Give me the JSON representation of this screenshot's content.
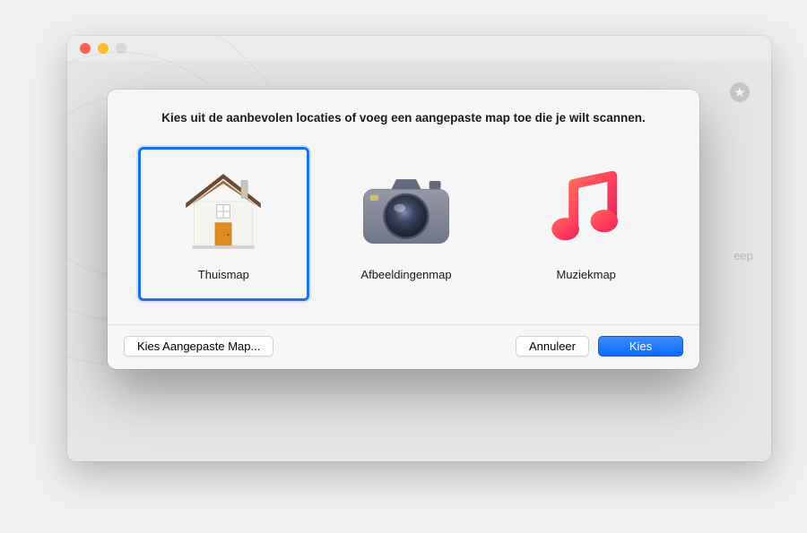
{
  "background": {
    "partial_text": "eep"
  },
  "modal": {
    "title": "Kies uit de aanbevolen locaties of voeg een aangepaste map toe die je wilt scannen.",
    "options": {
      "home": {
        "label": "Thuismap"
      },
      "pictures": {
        "label": "Afbeeldingenmap"
      },
      "music": {
        "label": "Muziekmap"
      }
    },
    "buttons": {
      "custom_folder": "Kies Aangepaste Map...",
      "cancel": "Annuleer",
      "choose": "Kies"
    }
  },
  "colors": {
    "selection": "#1a73e8",
    "primary_button": "#0a6bff"
  }
}
